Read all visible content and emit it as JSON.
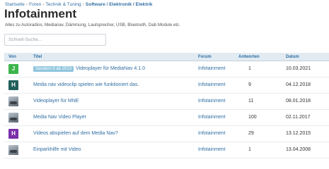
{
  "breadcrumb": {
    "items": [
      "Startseite",
      "Foren",
      "Technik & Tuning"
    ],
    "current": "Software / Elektronik / Elektrik",
    "separator": "›"
  },
  "page": {
    "title": "Infotainment",
    "subtitle": "Alles zu Autoradios, Medianav, Dämmung, Lautsprecher, USB, Bluetooth, Dab Module etc."
  },
  "search": {
    "placeholder": "Schnell-Suche...",
    "value": ""
  },
  "table": {
    "headers": {
      "von": "Von",
      "titel": "Titel",
      "forum": "Forum",
      "antworten": "Antworten",
      "datum": "Datum"
    },
    "rows": [
      {
        "avatar": {
          "type": "letter",
          "letter": "J",
          "color": "#3cb44b"
        },
        "badge": "Sandero II ab 2013",
        "title": "Videoplayer für MediaNav 4.1.0",
        "forum": "Infotainment",
        "answers": "1",
        "date": "10.03.2021"
      },
      {
        "avatar": {
          "type": "letter",
          "letter": "H",
          "color": "#1f5e5b"
        },
        "badge": "",
        "title": "Media nav videoclip spielen wie funktioniert das.",
        "forum": "Infotainment",
        "answers": "9",
        "date": "04.12.2018"
      },
      {
        "avatar": {
          "type": "photo",
          "icon": "car-photo"
        },
        "badge": "",
        "title": "Videoplayer für MNE",
        "forum": "Infotainment",
        "answers": "11",
        "date": "08.01.2018"
      },
      {
        "avatar": {
          "type": "photo",
          "icon": "car-photo"
        },
        "badge": "",
        "title": "Media Nav Video Player",
        "forum": "Infotainment",
        "answers": "100",
        "date": "02.11.2017"
      },
      {
        "avatar": {
          "type": "letter",
          "letter": "H",
          "color": "#7b2fa8"
        },
        "badge": "",
        "title": "Videos abspielen auf dem Media Nav?",
        "forum": "Infotainment",
        "answers": "29",
        "date": "13.12.2015"
      },
      {
        "avatar": {
          "type": "photo",
          "icon": "car-photo"
        },
        "badge": "",
        "title": "Einparkhilfe mit Video",
        "forum": "Infotainment",
        "answers": "1",
        "date": "13.04.2008"
      }
    ]
  }
}
